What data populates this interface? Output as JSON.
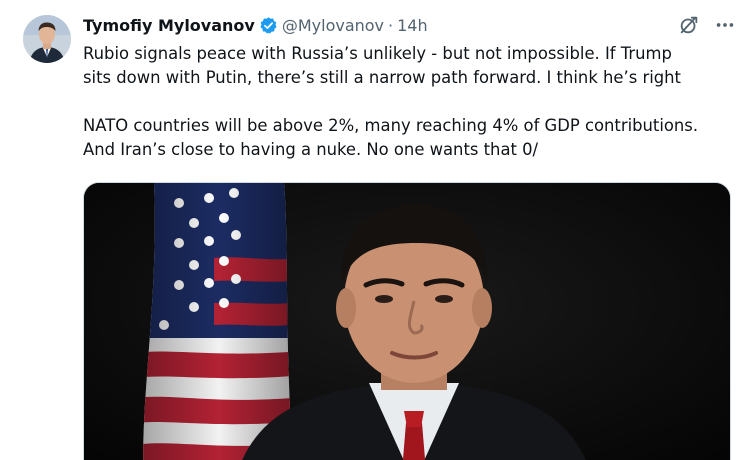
{
  "author": {
    "display_name": "Tymofiy Mylovanov",
    "handle": "@Mylovanov",
    "separator": "·",
    "time": "14h",
    "verified": true,
    "avatar_icon": "user-avatar"
  },
  "tweet": {
    "paragraphs": [
      {
        "lines": [
          "Rubio signals peace with Russia’s unlikely - but not impossible. If Trump",
          "sits down with Putin, there’s still a narrow path forward. I think he’s right"
        ]
      },
      {
        "lines": [
          "NATO countries will be above 2%, many reaching 4% of GDP contributions.",
          "And Iran’s close to having a nuke. No one wants that 0/"
        ]
      }
    ]
  },
  "actions": {
    "grok_icon": "grok-icon",
    "more_icon": "more-options-icon"
  },
  "media": {
    "type": "video-still",
    "description_icon": "video-thumbnail"
  },
  "colors": {
    "text": "#0f1419",
    "secondary": "#536471",
    "verified_blue": "#1d9bf0",
    "background": "#ffffff"
  }
}
